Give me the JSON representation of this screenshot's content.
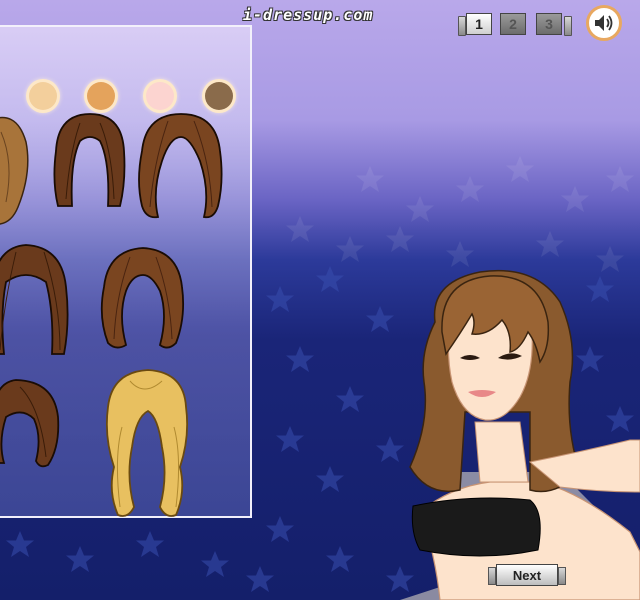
{
  "header": {
    "brand": "i-dressup.com"
  },
  "pages": {
    "items": [
      "1",
      "2",
      "3"
    ],
    "active_index": 0
  },
  "sound": {
    "icon": "speaker-icon",
    "state": "on"
  },
  "hair_panel": {
    "swatches": [
      {
        "color": "#f3cf9c",
        "name": "blonde-swatch"
      },
      {
        "color": "#e4a35c",
        "name": "caramel-swatch"
      },
      {
        "color": "#fcd4d0",
        "name": "pink-swatch"
      },
      {
        "color": "#8a6b4b",
        "name": "brown-swatch"
      }
    ],
    "styles": [
      {
        "name": "hairstyle-1",
        "color": "#a8743a"
      },
      {
        "name": "hairstyle-2",
        "color": "#6a3a1c"
      },
      {
        "name": "hairstyle-3",
        "color": "#7a4520"
      },
      {
        "name": "hairstyle-4",
        "color": "#6a3a1c"
      },
      {
        "name": "hairstyle-5",
        "color": "#7a4520"
      },
      {
        "name": "hairstyle-6",
        "color": "#6a3a1c"
      },
      {
        "name": "hairstyle-7",
        "color": "#e8c060"
      }
    ]
  },
  "doll": {
    "hair_color": "#8a5a2e",
    "skin_color": "#fde3cc",
    "top_color": "#1a1a1a"
  },
  "footer": {
    "next_label": "Next"
  }
}
